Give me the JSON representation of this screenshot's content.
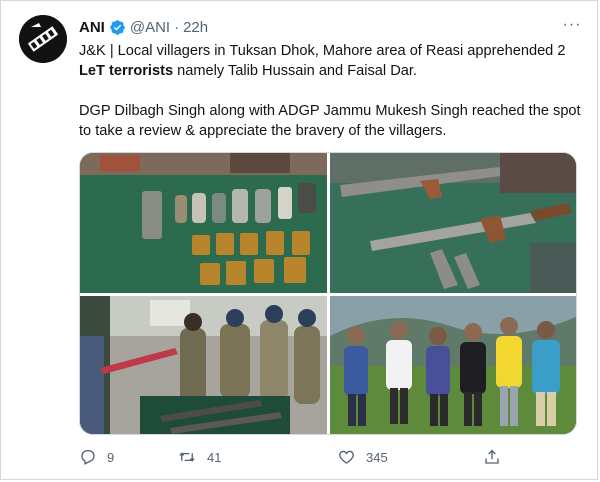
{
  "tweet": {
    "author_name": "ANI",
    "handle": "@ANI",
    "separator": "·",
    "time": "22h",
    "more": "···",
    "verified_icon": "verified-badge-icon",
    "line1_prefix": "J&K | Local villagers in Tuksan Dhok, Mahore area of Reasi apprehended 2",
    "line1_bold": "LeT terrorists",
    "line1_suffix": " namely Talib Hussain and Faisal Dar.",
    "paragraph2": "DGP Dilbagh Singh along with ADGP Jammu Mukesh Singh reached the spot to take a review & appreciate the bravery of the villagers."
  },
  "media": {
    "photos": [
      "seized-weapons-and-ammunition",
      "seized-rifles",
      "officials-inspecting-weapons",
      "villagers-group-photo"
    ]
  },
  "actions": {
    "reply_count": "9",
    "retweet_count": "41",
    "like_count": "345"
  },
  "colors": {
    "verified": "#1d9bf0",
    "secondary_text": "#536471",
    "border": "#cfd9de"
  }
}
